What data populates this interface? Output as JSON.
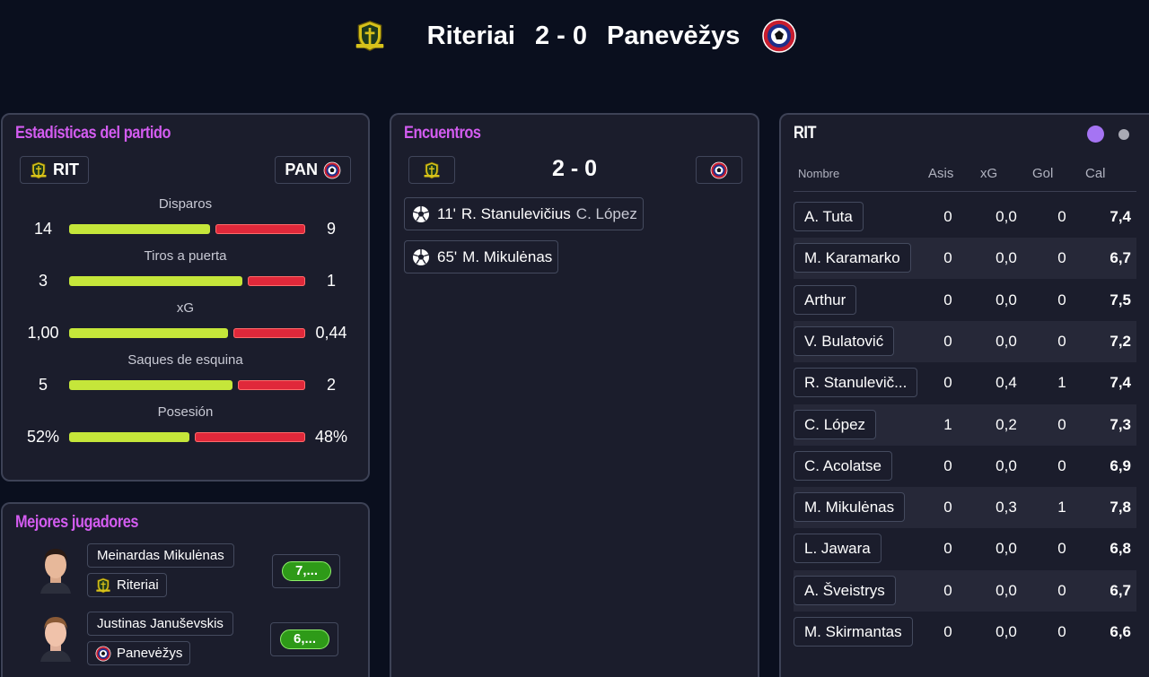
{
  "header": {
    "home_team": "Riteriai",
    "score": "2 - 0",
    "away_team": "Panevėžys"
  },
  "stats_panel": {
    "title": "Estadísticas del partido",
    "home_abbr": "RIT",
    "away_abbr": "PAN",
    "rows": [
      {
        "label": "Disparos",
        "home": "14",
        "away": "9",
        "home_share": 0.61
      },
      {
        "label": "Tiros a puerta",
        "home": "3",
        "away": "1",
        "home_share": 0.75
      },
      {
        "label": "xG",
        "home": "1,00",
        "away": "0,44",
        "home_share": 0.69
      },
      {
        "label": "Saques de esquina",
        "home": "5",
        "away": "2",
        "home_share": 0.71
      },
      {
        "label": "Posesión",
        "home": "52%",
        "away": "48%",
        "home_share": 0.52
      }
    ]
  },
  "best_players": {
    "title": "Mejores jugadores",
    "players": [
      {
        "name": "Meinardas Mikulėnas",
        "team": "Riteriai",
        "rating": "7,..."
      },
      {
        "name": "Justinas Januševskis",
        "team": "Panevėžys",
        "rating": "6,..."
      }
    ]
  },
  "encounters": {
    "title": "Encuentros",
    "score": "2 - 0",
    "goals": [
      {
        "minute": "11'",
        "scorer": "R. Stanulevičius",
        "assist": "C. López"
      },
      {
        "minute": "65'",
        "scorer": "M. Mikulėnas",
        "assist": ""
      }
    ]
  },
  "lineup": {
    "title": "RIT",
    "columns": [
      "Nombre",
      "Asis",
      "xG",
      "Gol",
      "Cal"
    ],
    "players": [
      {
        "name": "A. Tuta",
        "asis": "0",
        "xg": "0,0",
        "gol": "0",
        "cal": "7,4"
      },
      {
        "name": "M. Karamarko",
        "asis": "0",
        "xg": "0,0",
        "gol": "0",
        "cal": "6,7"
      },
      {
        "name": "Arthur",
        "asis": "0",
        "xg": "0,0",
        "gol": "0",
        "cal": "7,5"
      },
      {
        "name": "V. Bulatović",
        "asis": "0",
        "xg": "0,0",
        "gol": "0",
        "cal": "7,2"
      },
      {
        "name": "R. Stanulevič...",
        "asis": "0",
        "xg": "0,4",
        "gol": "1",
        "cal": "7,4"
      },
      {
        "name": "C. López",
        "asis": "1",
        "xg": "0,2",
        "gol": "0",
        "cal": "7,3"
      },
      {
        "name": "C. Acolatse",
        "asis": "0",
        "xg": "0,0",
        "gol": "0",
        "cal": "6,9"
      },
      {
        "name": "M. Mikulėnas",
        "asis": "0",
        "xg": "0,3",
        "gol": "1",
        "cal": "7,8"
      },
      {
        "name": "L. Jawara",
        "asis": "0",
        "xg": "0,0",
        "gol": "0",
        "cal": "6,8"
      },
      {
        "name": "A. Šveistrys",
        "asis": "0",
        "xg": "0,0",
        "gol": "0",
        "cal": "6,7"
      },
      {
        "name": "M. Skirmantas",
        "asis": "0",
        "xg": "0,0",
        "gol": "0",
        "cal": "6,6"
      }
    ]
  },
  "colors": {
    "home_bar": "#c5e63a",
    "away_bar": "#e0283a",
    "title_accent": "#d35cf0",
    "rating_good": "#2e9a18",
    "page_dot_active": "#a574f3"
  },
  "icons": {
    "home_crest": "riteriai-crest-icon",
    "away_crest": "panevezys-crest-icon",
    "goal": "soccer-ball-icon"
  }
}
